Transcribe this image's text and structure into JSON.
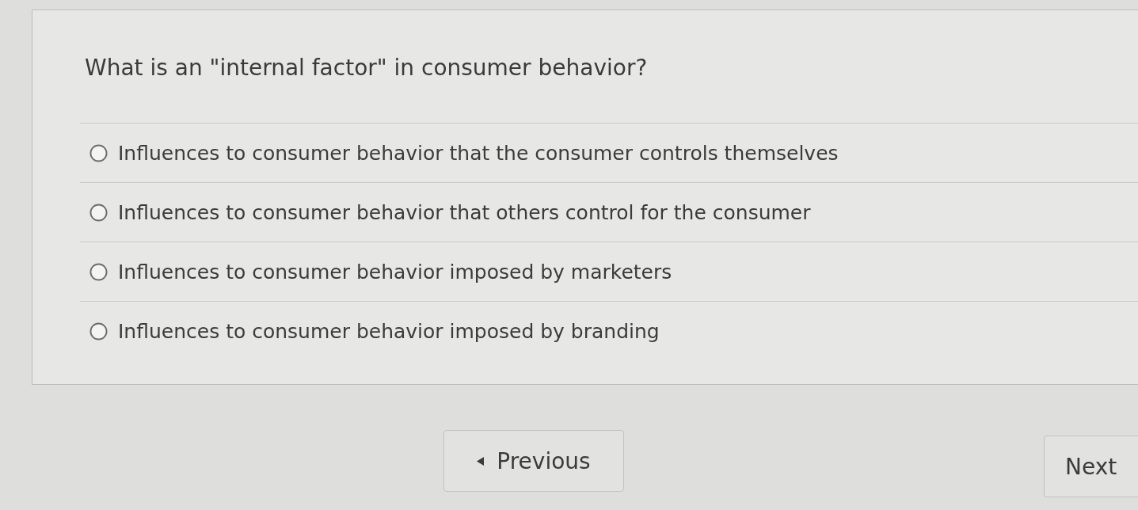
{
  "question": {
    "text": "What is an \"internal factor\" in consumer behavior?"
  },
  "options": [
    {
      "label": "Influences to consumer behavior that the consumer controls themselves",
      "selected": false
    },
    {
      "label": "Influences to consumer behavior that others control for the consumer",
      "selected": false
    },
    {
      "label": "Influences to consumer behavior imposed by marketers",
      "selected": false
    },
    {
      "label": "Influences to consumer behavior imposed by branding",
      "selected": false
    }
  ],
  "navigation": {
    "previous": {
      "label": "Previous"
    },
    "next": {
      "label": "Next"
    }
  }
}
